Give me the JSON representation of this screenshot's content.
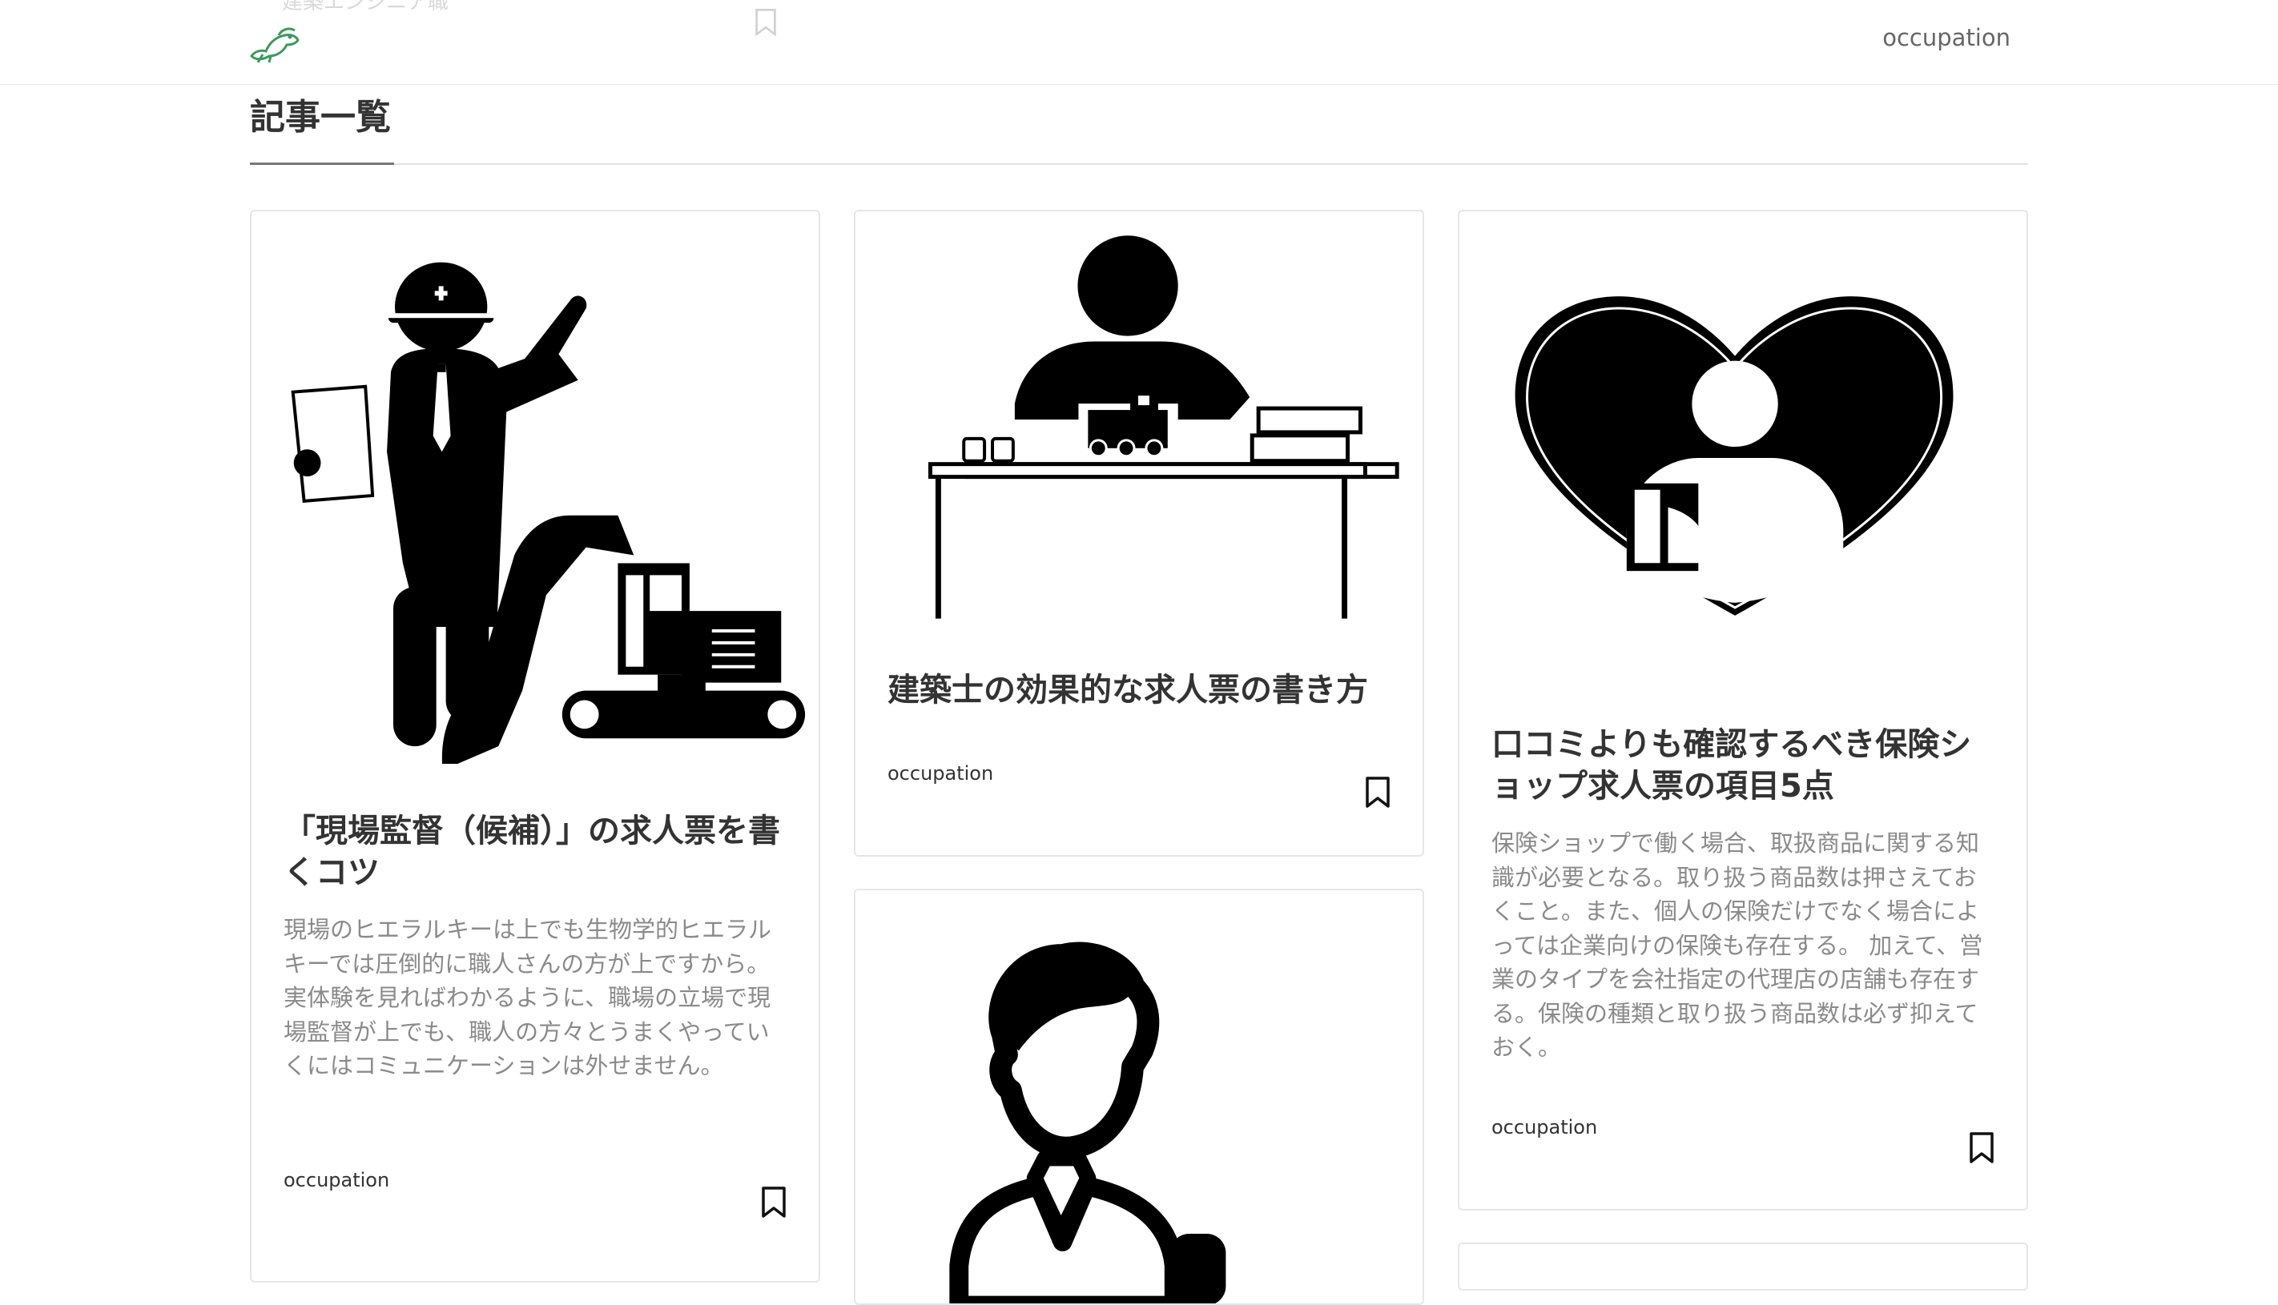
{
  "header": {
    "logo_icon": "beaver-logo-icon",
    "ghost_text": "建築エンジニア職",
    "nav_link": "occupation"
  },
  "section": {
    "title": "記事一覧"
  },
  "cards": [
    {
      "image_icon": "construction-supervisor-excavator-icon",
      "title": "「現場監督（候補）」の求人票を書くコツ",
      "excerpt": "現場のヒエラルキーは上でも生物学的ヒエラルキーでは圧倒的に職人さんの方が上ですから。実体験を見ればわかるように、職場の立場で現場監督が上でも、職人の方々とうまくやっていくにはコミュニケーションは外せません。",
      "tag": "occupation",
      "bookmark_icon": "bookmark-icon"
    },
    {
      "image_icon": "architect-at-desk-icon",
      "title": "建築士の効果的な求人票の書き方",
      "tag": "occupation",
      "bookmark_icon": "bookmark-icon"
    },
    {
      "image_icon": "insurance-heart-person-icon",
      "title": "口コミよりも確認するべき保険ショップ求人票の項目5点",
      "excerpt": "保険ショップで働く場合、取扱商品に関する知識が必要となる。取り扱う商品数は押さえておくこと。また、個人の保険だけでなく場合によっては企業向けの保険も存在する。 加えて、営業のタイプを会社指定の代理店の店舗も存在する。保険の種類と取り扱う商品数は必ず抑えておく。",
      "tag": "occupation",
      "bookmark_icon": "bookmark-icon"
    },
    {
      "image_icon": "person-in-suit-icon"
    }
  ]
}
